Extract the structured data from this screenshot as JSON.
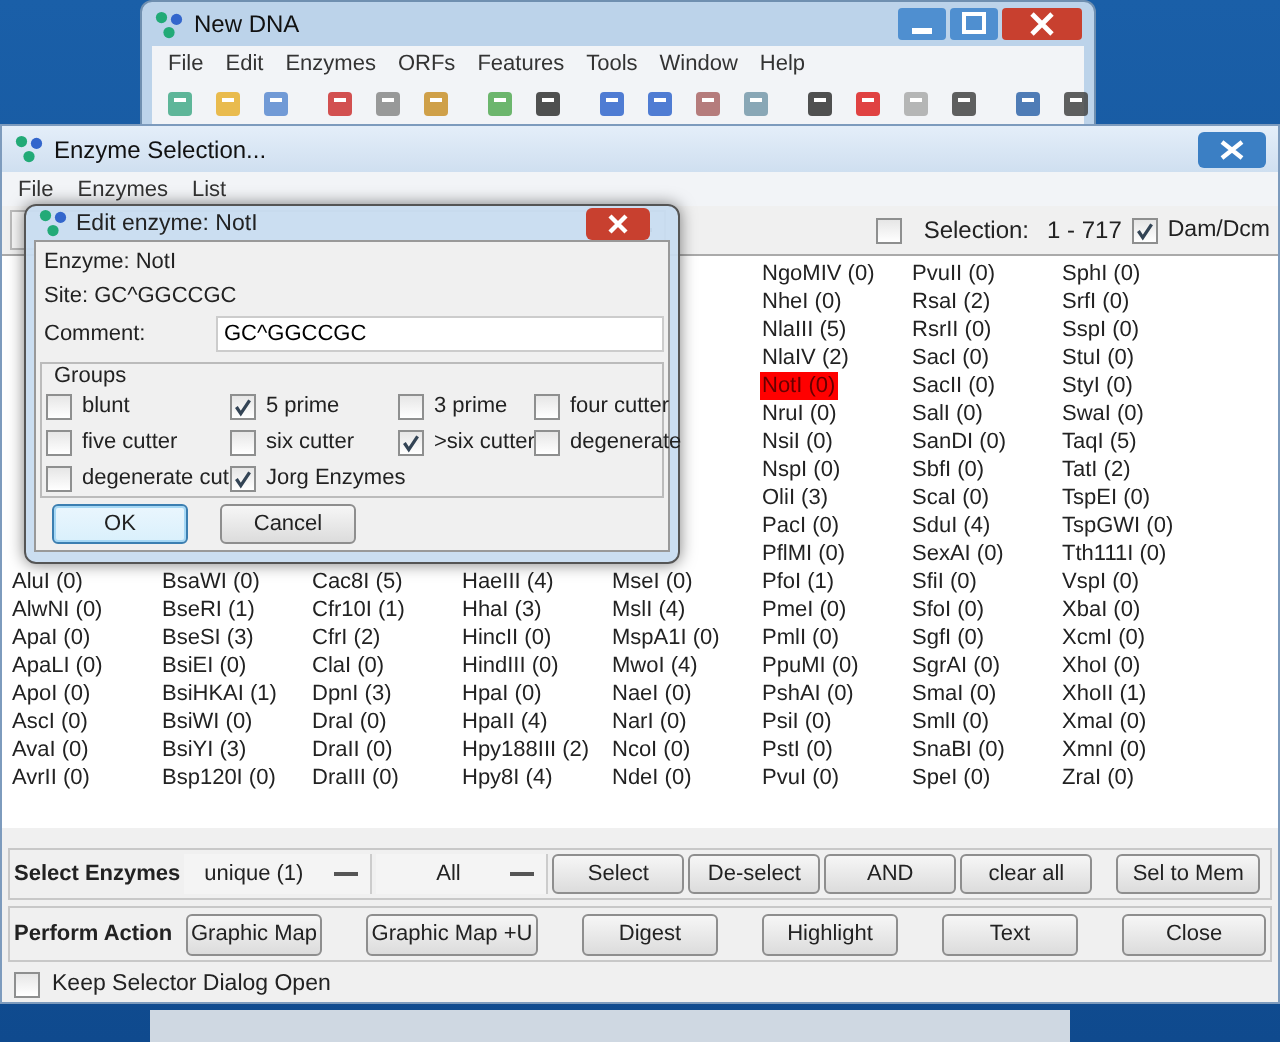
{
  "background_window": {
    "title": "New DNA",
    "menu": [
      "File",
      "Edit",
      "Enzymes",
      "ORFs",
      "Features",
      "Tools",
      "Window",
      "Help"
    ]
  },
  "enzyme_window": {
    "title": "Enzyme Selection...",
    "menu": [
      "File",
      "Enzymes",
      "List"
    ],
    "selection_checkbox": {
      "checked": false
    },
    "selection_label": "Selection:",
    "selection_range": "1 - 717",
    "dam_dcm": {
      "label": "Dam/Dcm",
      "checked": true
    },
    "enzyme_columns": [
      [
        {
          "name": "AluI (0)",
          "selected": false
        },
        {
          "name": "AlwNI (0)",
          "selected": false
        },
        {
          "name": "ApaI (0)",
          "selected": false
        },
        {
          "name": "ApaLI (0)",
          "selected": false
        },
        {
          "name": "ApoI (0)",
          "selected": false
        },
        {
          "name": "AscI (0)",
          "selected": false
        },
        {
          "name": "AvaI (0)",
          "selected": false
        },
        {
          "name": "AvrII (0)",
          "selected": false
        }
      ],
      [
        {
          "name": "BsaWI (0)",
          "selected": false
        },
        {
          "name": "BseRI (1)",
          "selected": false
        },
        {
          "name": "BseSI (3)",
          "selected": false
        },
        {
          "name": "BsiEI (0)",
          "selected": false
        },
        {
          "name": "BsiHKAI (1)",
          "selected": false
        },
        {
          "name": "BsiWI (0)",
          "selected": false
        },
        {
          "name": "BsiYI (3)",
          "selected": false
        },
        {
          "name": "Bsp120I (0)",
          "selected": false
        }
      ],
      [
        {
          "name": "Cac8I (5)",
          "selected": false
        },
        {
          "name": "Cfr10I (1)",
          "selected": false
        },
        {
          "name": "CfrI (2)",
          "selected": false
        },
        {
          "name": "ClaI (0)",
          "selected": false
        },
        {
          "name": "DpnI (3)",
          "selected": false
        },
        {
          "name": "DraI (0)",
          "selected": false
        },
        {
          "name": "DraII (0)",
          "selected": false
        },
        {
          "name": "DraIII (0)",
          "selected": false
        }
      ],
      [
        {
          "name": "HaeIII (4)",
          "selected": false
        },
        {
          "name": "HhaI (3)",
          "selected": false
        },
        {
          "name": "HincII (0)",
          "selected": false
        },
        {
          "name": "HindIII (0)",
          "selected": false
        },
        {
          "name": "HpaI (0)",
          "selected": false
        },
        {
          "name": "HpaII (4)",
          "selected": false
        },
        {
          "name": "Hpy188III (2)",
          "selected": false
        },
        {
          "name": "Hpy8I (4)",
          "selected": false
        }
      ],
      [
        {
          "name": "MseI (0)",
          "selected": false
        },
        {
          "name": "MslI (4)",
          "selected": false
        },
        {
          "name": "MspA1I (0)",
          "selected": false
        },
        {
          "name": "MwoI (4)",
          "selected": false
        },
        {
          "name": "NaeI (0)",
          "selected": false
        },
        {
          "name": "NarI (0)",
          "selected": false
        },
        {
          "name": "NcoI (0)",
          "selected": false
        },
        {
          "name": "NdeI (0)",
          "selected": false
        }
      ],
      [
        {
          "name": "NgoMIV (0)",
          "selected": false
        },
        {
          "name": "NheI (0)",
          "selected": false
        },
        {
          "name": "NlaIII (5)",
          "selected": false
        },
        {
          "name": "NlaIV (2)",
          "selected": false
        },
        {
          "name": "NotI (0)",
          "selected": true
        },
        {
          "name": "NruI (0)",
          "selected": false
        },
        {
          "name": "NsiI (0)",
          "selected": false
        },
        {
          "name": "NspI (0)",
          "selected": false
        },
        {
          "name": "OliI (3)",
          "selected": false
        },
        {
          "name": "PacI (0)",
          "selected": false
        },
        {
          "name": "PflMI (0)",
          "selected": false
        },
        {
          "name": "PfoI (1)",
          "selected": false
        },
        {
          "name": "PmeI (0)",
          "selected": false
        },
        {
          "name": "PmlI (0)",
          "selected": false
        },
        {
          "name": "PpuMI (0)",
          "selected": false
        },
        {
          "name": "PshAI (0)",
          "selected": false
        },
        {
          "name": "PsiI (0)",
          "selected": false
        },
        {
          "name": "PstI (0)",
          "selected": false
        },
        {
          "name": "PvuI (0)",
          "selected": false
        }
      ],
      [
        {
          "name": "PvuII (0)",
          "selected": false
        },
        {
          "name": "RsaI (2)",
          "selected": false
        },
        {
          "name": "RsrII (0)",
          "selected": false
        },
        {
          "name": "SacI (0)",
          "selected": false
        },
        {
          "name": "SacII (0)",
          "selected": false
        },
        {
          "name": "SalI (0)",
          "selected": false
        },
        {
          "name": "SanDI (0)",
          "selected": false
        },
        {
          "name": "SbfI (0)",
          "selected": false
        },
        {
          "name": "ScaI (0)",
          "selected": false
        },
        {
          "name": "SduI (4)",
          "selected": false
        },
        {
          "name": "SexAI (0)",
          "selected": false
        },
        {
          "name": "SfiI (0)",
          "selected": false
        },
        {
          "name": "SfoI (0)",
          "selected": false
        },
        {
          "name": "SgfI (0)",
          "selected": false
        },
        {
          "name": "SgrAI (0)",
          "selected": false
        },
        {
          "name": "SmaI (0)",
          "selected": false
        },
        {
          "name": "SmlI (0)",
          "selected": false
        },
        {
          "name": "SnaBI (0)",
          "selected": false
        },
        {
          "name": "SpeI (0)",
          "selected": false
        }
      ],
      [
        {
          "name": "SphI (0)",
          "selected": false
        },
        {
          "name": "SrfI (0)",
          "selected": false
        },
        {
          "name": "SspI (0)",
          "selected": false
        },
        {
          "name": "StuI (0)",
          "selected": false
        },
        {
          "name": "StyI (0)",
          "selected": false
        },
        {
          "name": "SwaI (0)",
          "selected": false
        },
        {
          "name": "TaqI (5)",
          "selected": false
        },
        {
          "name": "TatI (2)",
          "selected": false
        },
        {
          "name": "TspEI (0)",
          "selected": false
        },
        {
          "name": "TspGWI (0)",
          "selected": false
        },
        {
          "name": "Tth111I (0)",
          "selected": false
        },
        {
          "name": "VspI (0)",
          "selected": false
        },
        {
          "name": "XbaI (0)",
          "selected": false
        },
        {
          "name": "XcmI (0)",
          "selected": false
        },
        {
          "name": "XhoI (0)",
          "selected": false
        },
        {
          "name": "XhoII (1)",
          "selected": false
        },
        {
          "name": "XmaI (0)",
          "selected": false
        },
        {
          "name": "XmnI (0)",
          "selected": false
        },
        {
          "name": "ZraI (0)",
          "selected": false
        }
      ]
    ],
    "select_row": {
      "label": "Select Enzymes",
      "dropdowns": [
        "unique (1)",
        "All"
      ],
      "buttons": [
        "Select",
        "De-select",
        "AND",
        "clear all",
        "Sel to Mem"
      ]
    },
    "action_row": {
      "label": "Perform Action",
      "buttons": [
        "Graphic Map",
        "Graphic Map +U",
        "Digest",
        "Highlight",
        "Text",
        "Close"
      ]
    },
    "keep_open": {
      "label": "Keep Selector Dialog Open",
      "checked": false
    }
  },
  "dialog": {
    "title": "Edit enzyme: NotI",
    "enzyme": "Enzyme: NotI",
    "site": "Site: GC^GGCCGC",
    "comment_label": "Comment:",
    "comment_value": "GC^GGCCGC",
    "groups_title": "Groups",
    "groups": [
      {
        "label": "blunt",
        "checked": false
      },
      {
        "label": "5 prime",
        "checked": true
      },
      {
        "label": "3 prime",
        "checked": false
      },
      {
        "label": "four cutter",
        "checked": false
      },
      {
        "label": "five cutter",
        "checked": false
      },
      {
        "label": "six cutter",
        "checked": false
      },
      {
        "label": ">six cutter",
        "checked": true
      },
      {
        "label": "degenerate",
        "checked": false
      },
      {
        "label": "degenerate cut",
        "checked": false
      },
      {
        "label": "Jorg Enzymes",
        "checked": true
      }
    ],
    "buttons": [
      {
        "label": "OK",
        "focused": true
      },
      {
        "label": "Cancel",
        "focused": false
      }
    ]
  }
}
